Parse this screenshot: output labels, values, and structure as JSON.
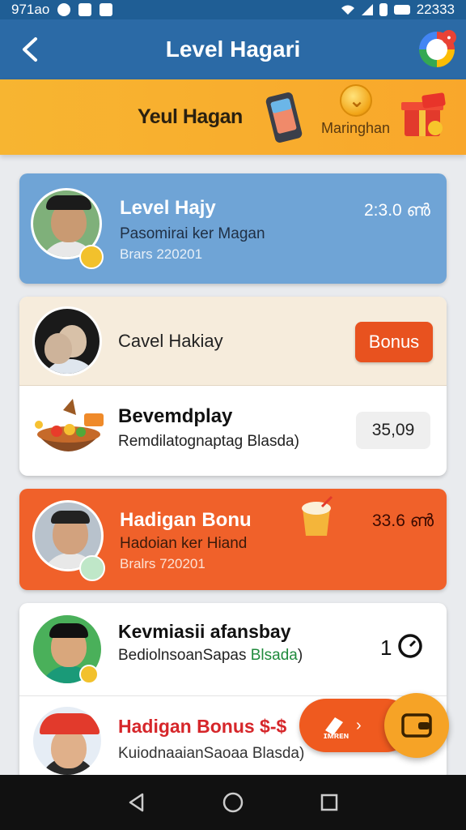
{
  "status_bar": {
    "time_left": "971ao",
    "time_right": "22333"
  },
  "app_bar": {
    "title": "Level Hagari"
  },
  "banner": {
    "title": "Yeul Hagan",
    "subtitle": "Maringhan"
  },
  "cards": [
    {
      "title": "Level Hajy",
      "subtitle": "Pasomirai ker Magan",
      "meta": "Brars 220201",
      "value": "2:3.0 ൺ"
    },
    {
      "top_title": "Cavel Hakiay",
      "button_label": "Bonus",
      "title": "Bevemdplay",
      "subtitle": "Remdilatognaptag Blasda)",
      "value": "35,09"
    },
    {
      "title": "Hadigan Bonu",
      "subtitle": "Hadoian ker Hiand",
      "meta": "Bralrs 720201",
      "value": "33.6 ൺ"
    },
    {
      "title": "Kevmiasii afansbay",
      "subtitle_a": "BediolnsoanSapas ",
      "subtitle_b": "Blsada",
      "subtitle_c": ")",
      "value": "1"
    }
  ],
  "bottom_item": {
    "title": "Hadigan Bonus $-$",
    "subtitle": "KuiodnaaianSaoaa Blasda)"
  },
  "fab": {
    "label": "ɪᴍʀᴇɴ",
    "chevron": "›"
  },
  "colors": {
    "app_bar": "#2b6aa6",
    "banner": "#f7b531",
    "card_blue": "#6fa4d6",
    "card_orange": "#f0612a",
    "accent_orange": "#e8521f",
    "accent_green": "#1f8a3c"
  }
}
